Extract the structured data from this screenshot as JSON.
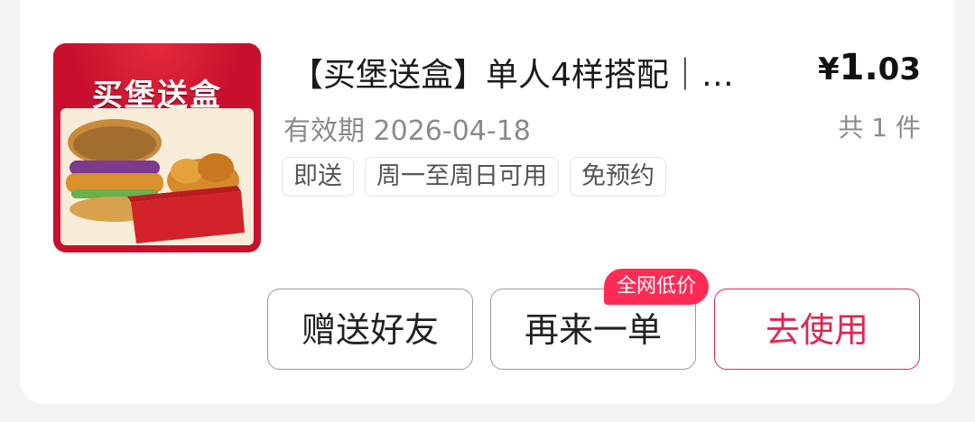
{
  "order": {
    "thumbnail_title": "买堡送盒",
    "item_title": "【买堡送盒】单人4样搭配｜…",
    "price_symbol": "¥",
    "price_main": "1.",
    "price_cents": "03",
    "validity": "有效期 2026-04-18",
    "quantity": "共 1 件",
    "tags": [
      "即送",
      "周一至周日可用",
      "免预约"
    ]
  },
  "actions": {
    "gift_label": "赠送好友",
    "reorder_label": "再来一单",
    "reorder_badge": "全网低价",
    "use_label": "去使用"
  },
  "colors": {
    "accent": "#e0264f",
    "badge": "#ff2b55",
    "page_bg": "#f3f3f5"
  }
}
